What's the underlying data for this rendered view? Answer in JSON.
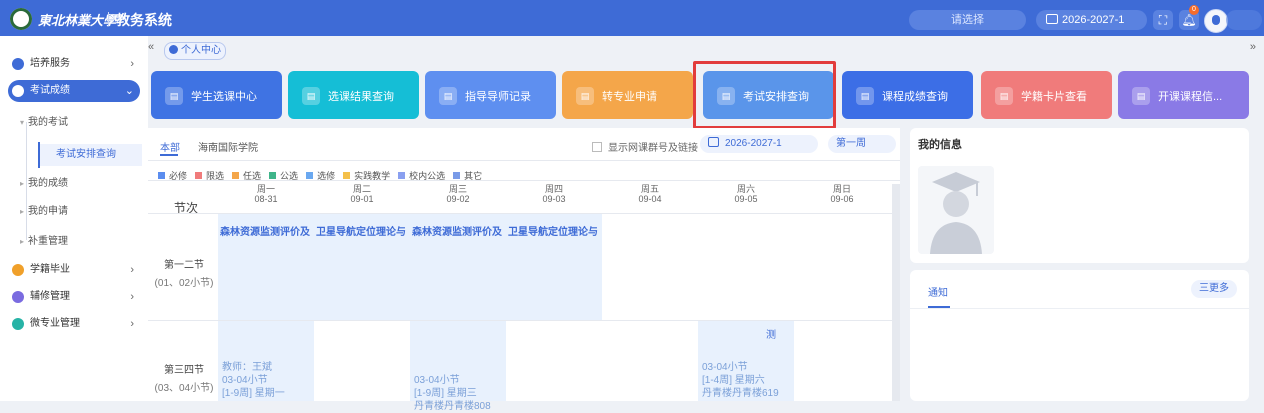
{
  "header": {
    "school_name": "東北林業大學",
    "system_title": "教务系统",
    "select_placeholder": "请选择",
    "term": "2026-2027-1",
    "notification_count": "0"
  },
  "sidebar": {
    "items": [
      {
        "label": "培养服务",
        "color": "#3e6bd6"
      },
      {
        "label": "考试成绩",
        "color": "#3e6bd6"
      },
      {
        "label": "学籍毕业",
        "color": "#f0a02a"
      },
      {
        "label": "辅修管理",
        "color": "#7a6be0"
      },
      {
        "label": "微专业管理",
        "color": "#27b3a6"
      }
    ],
    "sub_items": [
      "我的考试",
      "考试安排查询",
      "我的成绩",
      "我的申请",
      "补重管理"
    ]
  },
  "tabs": {
    "collapse_left": "«",
    "collapse_right": "»",
    "personal_center": "个人中心"
  },
  "quick_links": [
    {
      "label": "学生选课中心",
      "color": "#3f73e3"
    },
    {
      "label": "选课结果查询",
      "color": "#15bed6"
    },
    {
      "label": "指导导师记录",
      "color": "#5e8ff0"
    },
    {
      "label": "转专业申请",
      "color": "#f4a64a"
    },
    {
      "label": "考试安排查询",
      "color": "#5a95ea"
    },
    {
      "label": "课程成绩查询",
      "color": "#3c6ee6"
    },
    {
      "label": "学籍卡片查看",
      "color": "#f07b7b"
    },
    {
      "label": "开课课程信...",
      "color": "#8a7ae6"
    }
  ],
  "schedule": {
    "tab_all": "本部",
    "tab_hainan": "海南国际学院",
    "show_group": "显示网课群号及链接",
    "term": "2026-2027-1",
    "week": "第一周",
    "legend": [
      {
        "label": "必修",
        "color": "#5b8def"
      },
      {
        "label": "限选",
        "color": "#f07b7b"
      },
      {
        "label": "任选",
        "color": "#f4a64a"
      },
      {
        "label": "公选",
        "color": "#3fb58a"
      },
      {
        "label": "选修",
        "color": "#6aa8f0"
      },
      {
        "label": "实践教学",
        "color": "#f4c04a"
      },
      {
        "label": "校内公选",
        "color": "#8aa0f0"
      },
      {
        "label": "其它",
        "color": "#7a9be8"
      }
    ],
    "section_header": "节次",
    "days": [
      {
        "day": "周一",
        "date": "08-31"
      },
      {
        "day": "周二",
        "date": "09-01"
      },
      {
        "day": "周三",
        "date": "09-02"
      },
      {
        "day": "周四",
        "date": "09-03"
      },
      {
        "day": "周五",
        "date": "09-04"
      },
      {
        "day": "周六",
        "date": "09-05"
      },
      {
        "day": "周日",
        "date": "09-06"
      }
    ],
    "rows": [
      {
        "name": "第一二节",
        "range": "(01、02小节)"
      },
      {
        "name": "第三四节",
        "range": "(03、04小节)"
      }
    ],
    "courses": [
      {
        "title": "森林资源监测评价及"
      },
      {
        "title": "卫星导航定位理论与"
      },
      {
        "title": "森林资源监测评价及"
      },
      {
        "title": "卫星导航定位理论与"
      }
    ],
    "row2_cells": [
      {
        "lines": [
          "教师：王斌",
          "03-04小节",
          "[1-9周] 星期一"
        ]
      },
      {
        "lines": [
          "03-04小节",
          "[1-9周] 星期三",
          "丹青楼丹青楼808"
        ]
      },
      {
        "lines": [
          "测",
          "03-04小节",
          "[1-4周] 星期六",
          "丹青楼丹青楼619"
        ]
      }
    ]
  },
  "info": {
    "title": "我的信息"
  },
  "notice": {
    "title": "通知",
    "more": "三更多"
  }
}
